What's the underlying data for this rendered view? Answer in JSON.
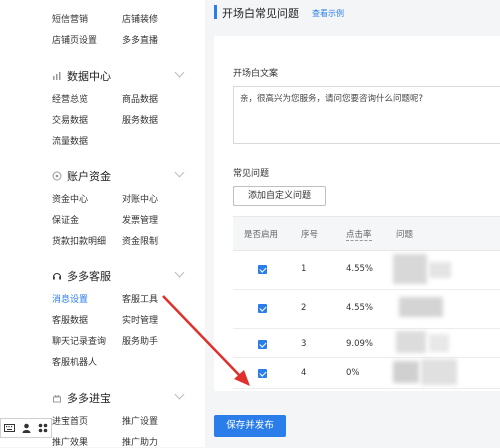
{
  "sidebar": {
    "top_rows": [
      {
        "col1": "短信营销",
        "col2": "店铺装修"
      },
      {
        "col1": "店铺页设置",
        "col2": "多多直播"
      }
    ],
    "sections": [
      {
        "title": "数据中心",
        "icon": "bar-chart-icon",
        "rows": [
          [
            "经营总览",
            "商品数据"
          ],
          [
            "交易数据",
            "服务数据"
          ],
          [
            "流量数据",
            ""
          ]
        ]
      },
      {
        "title": "账户资金",
        "icon": "coin-icon",
        "rows": [
          [
            "资金中心",
            "对账中心"
          ],
          [
            "保证金",
            "发票管理"
          ],
          [
            "货款扣款明细",
            "资金限制"
          ]
        ]
      },
      {
        "title": "多多客服",
        "icon": "headset-icon",
        "rows": [
          [
            "消息设置",
            "客服工具"
          ],
          [
            "客服数据",
            "实时管理"
          ],
          [
            "聊天记录查询",
            "服务助手"
          ],
          [
            "客服机器人",
            ""
          ]
        ]
      },
      {
        "title": "多多进宝",
        "icon": "gift-icon",
        "rows": [
          [
            "进宝首页",
            "推广设置"
          ],
          [
            "推广效果",
            "推广助力"
          ]
        ]
      }
    ],
    "active_item": "消息设置"
  },
  "page": {
    "title": "开场白常见问题",
    "example_link": "查看示例",
    "opening_label": "开场白文案",
    "opening_text": "亲，很高兴为您服务，请问您要咨询什么问题呢?",
    "faq_label": "常见问题",
    "add_button": "添加自定义问题",
    "table": {
      "headers": [
        "是否启用",
        "序号",
        "点击率",
        "问题"
      ],
      "rows": [
        {
          "enabled": true,
          "index": "1",
          "rate": "4.55%"
        },
        {
          "enabled": true,
          "index": "2",
          "rate": "4.55%"
        },
        {
          "enabled": true,
          "index": "3",
          "rate": "9.09%"
        },
        {
          "enabled": true,
          "index": "4",
          "rate": "0%"
        }
      ]
    },
    "publish_button": "保存并发布"
  },
  "toolbar": {
    "icons": [
      "keyboard-icon",
      "user-icon",
      "settings-icon"
    ]
  },
  "colors": {
    "accent": "#2b7de9",
    "annotation_arrow": "#e0302b"
  }
}
